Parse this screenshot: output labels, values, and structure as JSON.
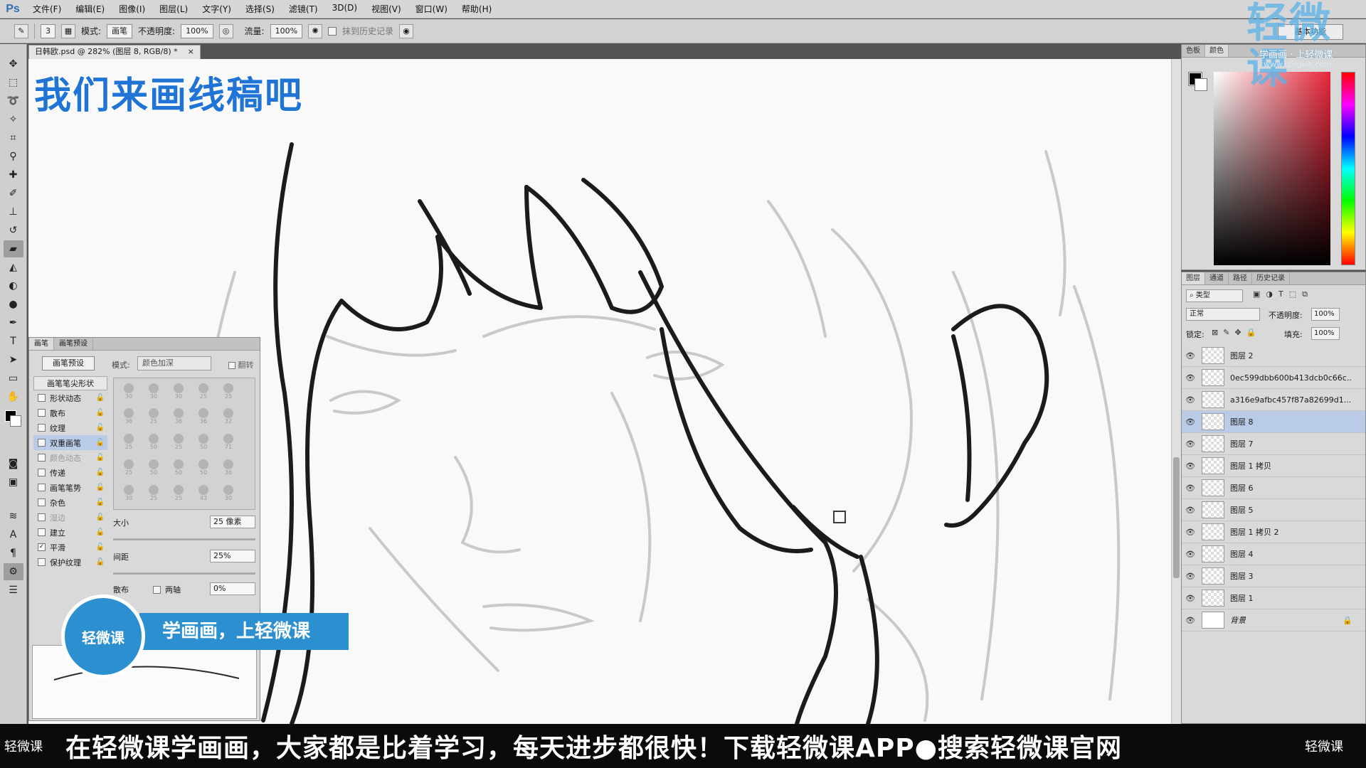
{
  "app": {
    "logo": "Ps"
  },
  "menu": [
    "文件(F)",
    "编辑(E)",
    "图像(I)",
    "图层(L)",
    "文字(Y)",
    "选择(S)",
    "滤镜(T)",
    "3D(D)",
    "视图(V)",
    "窗口(W)",
    "帮助(H)"
  ],
  "options": {
    "brush_size": "3",
    "mode_label": "模式:",
    "mode_value": "画笔",
    "opacity_label": "不透明度:",
    "opacity_value": "100%",
    "flow_label": "流量:",
    "flow_value": "100%",
    "history_label": "抹到历史记录",
    "workspace": "基本功能"
  },
  "document": {
    "tab_title": "日韩欧.psd @ 282% (图层 8, RGB/8) *",
    "close": "×"
  },
  "overlay": {
    "title": "我们来画线稿吧"
  },
  "brush_panel": {
    "tabs": [
      "画笔",
      "画笔预设"
    ],
    "preset_button": "画笔预设",
    "mode_label": "模式:",
    "mode_value": "颜色加深",
    "flip_label": "翻转",
    "list_header": "画笔笔尖形状",
    "options": [
      {
        "label": "形状动态",
        "checked": false,
        "dim": false,
        "selected": false
      },
      {
        "label": "散布",
        "checked": false,
        "dim": false,
        "selected": false
      },
      {
        "label": "纹理",
        "checked": false,
        "dim": false,
        "selected": false
      },
      {
        "label": "双重画笔",
        "checked": false,
        "dim": false,
        "selected": true
      },
      {
        "label": "颜色动态",
        "checked": false,
        "dim": true,
        "selected": false
      },
      {
        "label": "传递",
        "checked": false,
        "dim": false,
        "selected": false
      },
      {
        "label": "画笔笔势",
        "checked": false,
        "dim": false,
        "selected": false
      },
      {
        "label": "杂色",
        "checked": false,
        "dim": false,
        "selected": false
      },
      {
        "label": "湿边",
        "checked": false,
        "dim": true,
        "selected": false
      },
      {
        "label": "建立",
        "checked": false,
        "dim": false,
        "selected": false
      },
      {
        "label": "平滑",
        "checked": true,
        "dim": false,
        "selected": false
      },
      {
        "label": "保护纹理",
        "checked": false,
        "dim": false,
        "selected": false
      }
    ],
    "tips": [
      "30",
      "30",
      "30",
      "25",
      "25",
      "36",
      "25",
      "36",
      "36",
      "32",
      "25",
      "50",
      "25",
      "50",
      "71",
      "25",
      "50",
      "50",
      "50",
      "36",
      "30",
      "25",
      "25",
      "43",
      "30"
    ],
    "size_label": "大小",
    "size_value": "25 像素",
    "spacing_label": "间距",
    "spacing_value": "25%",
    "scatter_label": "散布",
    "both_axes_label": "两轴",
    "scatter_value": "0%"
  },
  "color_panel": {
    "tabs": [
      "色板",
      "颜色"
    ]
  },
  "layers_panel": {
    "tabs": [
      "图层",
      "通道",
      "路径",
      "历史记录"
    ],
    "filter": "类型",
    "blend": "正常",
    "opacity_label": "不透明度:",
    "opacity_value": "100%",
    "lock_label": "锁定:",
    "fill_label": "填充:",
    "fill_value": "100%",
    "layers": [
      {
        "name": "图层 2",
        "selected": false,
        "white": false,
        "italic": false
      },
      {
        "name": "0ec599dbb600b413dcb0c66c...",
        "selected": false,
        "white": false,
        "italic": false
      },
      {
        "name": "a316e9afbc457f87a82699d1...",
        "selected": false,
        "white": false,
        "italic": false
      },
      {
        "name": "图层 8",
        "selected": true,
        "white": false,
        "italic": false
      },
      {
        "name": "图层 7",
        "selected": false,
        "white": false,
        "italic": false
      },
      {
        "name": "图层 1 拷贝",
        "selected": false,
        "white": false,
        "italic": false
      },
      {
        "name": "图层 6",
        "selected": false,
        "white": false,
        "italic": false
      },
      {
        "name": "图层 5",
        "selected": false,
        "white": false,
        "italic": false
      },
      {
        "name": "图层 1 拷贝 2",
        "selected": false,
        "white": false,
        "italic": false
      },
      {
        "name": "图层 4",
        "selected": false,
        "white": false,
        "italic": false
      },
      {
        "name": "图层 3",
        "selected": false,
        "white": false,
        "italic": false
      },
      {
        "name": "图层 1",
        "selected": false,
        "white": false,
        "italic": false
      },
      {
        "name": "背景",
        "selected": false,
        "white": true,
        "italic": true
      }
    ]
  },
  "watermark": {
    "logo": "轻微课",
    "subtitle": "学画画 · 上轻微课",
    "url": "www.qingwk.com"
  },
  "promo": {
    "badge": "轻微课",
    "slogan": "学画画，上轻微课"
  },
  "banner": {
    "left": "轻微课",
    "text": "在轻微课学画画，大家都是比着学习，每天进步都很快！下载轻微课APP●搜索轻微课官网",
    "right": "轻微课"
  }
}
